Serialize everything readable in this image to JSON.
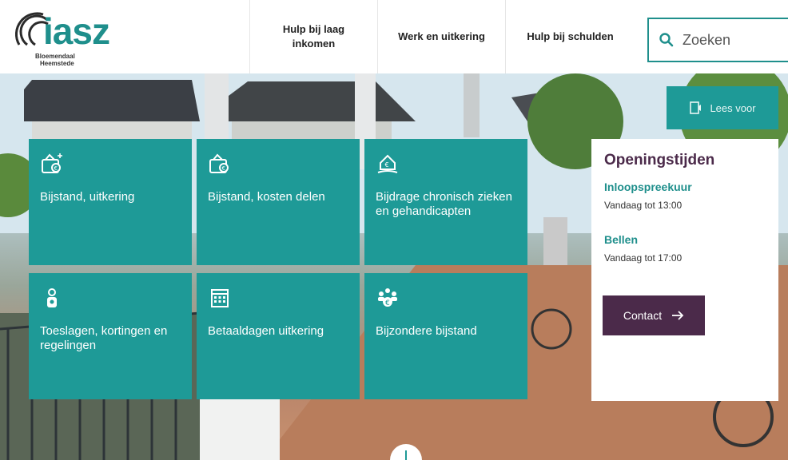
{
  "logo": {
    "word": "iasz",
    "line1": "Bloemendaal",
    "line2": "Heemstede"
  },
  "nav": {
    "item1": "Hulp bij laag inkomen",
    "item2": "Werk en uitkering",
    "item3": "Hulp bij schulden"
  },
  "search": {
    "placeholder": "Zoeken"
  },
  "read_aloud": {
    "label": "Lees voor"
  },
  "tiles": [
    {
      "label": "Bijstand, uitkering",
      "icon": "wallet-plus-icon"
    },
    {
      "label": "Bijstand, kosten delen",
      "icon": "wallet-icon"
    },
    {
      "label": "Bijdrage chronisch zieken en gehandicapten",
      "icon": "house-hand-icon"
    },
    {
      "label": "Toeslagen, kortingen en regelingen",
      "icon": "person-icon"
    },
    {
      "label": "Betaaldagen uitkering",
      "icon": "calendar-icon"
    },
    {
      "label": "Bijzondere bijstand",
      "icon": "people-euro-icon"
    }
  ],
  "hours": {
    "title": "Openingstijden",
    "walkin_title": "Inloopspreekuur",
    "walkin_time": "Vandaag tot 13:00",
    "call_title": "Bellen",
    "call_time": "Vandaag tot 17:00",
    "contact_label": "Contact"
  },
  "colors": {
    "teal": "#1e9a97",
    "purple": "#4b2a4a"
  }
}
